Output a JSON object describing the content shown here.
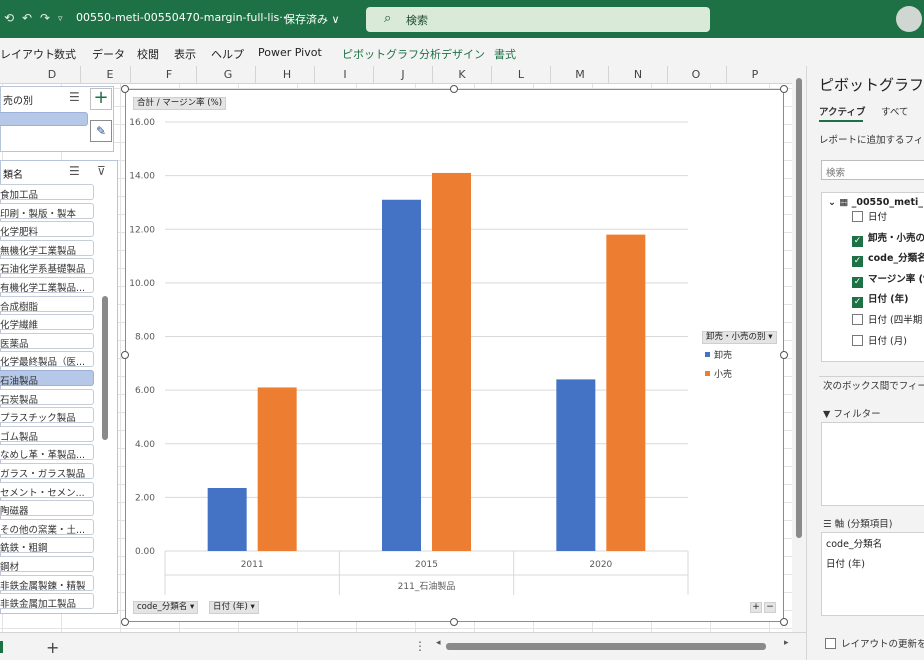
{
  "titlebar": {
    "filename": "00550-meti-00550470-margin-full-lis···",
    "saved": "保存済み ∨",
    "search_placeholder": "検索"
  },
  "ribbon": {
    "tabs": [
      "レイアウト",
      "数式",
      "データ",
      "校閲",
      "表示",
      "ヘルプ",
      "Power Pivot"
    ],
    "context_tabs": [
      "ピボットグラフ分析",
      "デザイン",
      "書式"
    ]
  },
  "columns": [
    "D",
    "E",
    "F",
    "G",
    "H",
    "I",
    "J",
    "K",
    "L",
    "M",
    "N",
    "O",
    "P"
  ],
  "slicer1": {
    "title": "売の別"
  },
  "slicer2": {
    "title": "類名",
    "items": [
      "食加工品",
      "印刷・製版・製本",
      "化学肥料",
      "無機化学工業製品",
      "石油化学系基礎製品",
      "有機化学工業製品...",
      "合成樹脂",
      "化学繊維",
      "医薬品",
      "化学最終製品（医...",
      "石油製品",
      "石炭製品",
      "プラスチック製品",
      "ゴム製品",
      "なめし革・革製品...",
      "ガラス・ガラス製品",
      "セメント・セメン...",
      "陶磁器",
      "その他の窯業・土...",
      "銑鉄・粗鋼",
      "鋼材",
      "非鉄金属製錬・精製",
      "非鉄金属加工製品"
    ],
    "selected_index": 10
  },
  "chart": {
    "value_field_button": "合計 / マージン率 (%)",
    "legend_field_button": "卸売・小売の別",
    "axis_field_buttons": [
      "code_分類名",
      "日付 (年)"
    ],
    "colors": {
      "wholesale": "#4472c4",
      "retail": "#ed7d31"
    }
  },
  "chart_data": {
    "type": "bar",
    "categories": [
      "2011",
      "2015",
      "2020"
    ],
    "series": [
      {
        "name": "卸売",
        "values": [
          2.35,
          13.1,
          6.4
        ]
      },
      {
        "name": "小売",
        "values": [
          6.1,
          14.1,
          11.8
        ]
      }
    ],
    "ylim": [
      0,
      16
    ],
    "yticks": [
      "0.00",
      "2.00",
      "4.00",
      "6.00",
      "8.00",
      "10.00",
      "12.00",
      "14.00",
      "16.00"
    ],
    "xgroup_label": "211_石油製品",
    "grid": true,
    "legend": "right"
  },
  "pane": {
    "title": "ピボットグラフの",
    "tab_active": "アクティブ",
    "tab_all": "すべて",
    "subtitle": "レポートに追加するフィール",
    "search_placeholder": "検索",
    "table_name": "_00550_meti_",
    "fields": [
      {
        "label": "日付",
        "checked": false
      },
      {
        "label": "卸売・小売の別",
        "checked": true
      },
      {
        "label": "code_分類名",
        "checked": true
      },
      {
        "label": "マージン率 (%",
        "checked": true
      },
      {
        "label": "日付 (年)",
        "checked": true
      },
      {
        "label": "日付 (四半期",
        "checked": false
      },
      {
        "label": "日付 (月)",
        "checked": false
      }
    ],
    "drag_hint": "次のボックス間でフィールド",
    "filter_label": "フィルター",
    "axis_label": "軸 (分類項目)",
    "axis_items": [
      "code_分類名",
      "日付 (年)"
    ],
    "defer_label": "レイアウトの更新を保"
  }
}
